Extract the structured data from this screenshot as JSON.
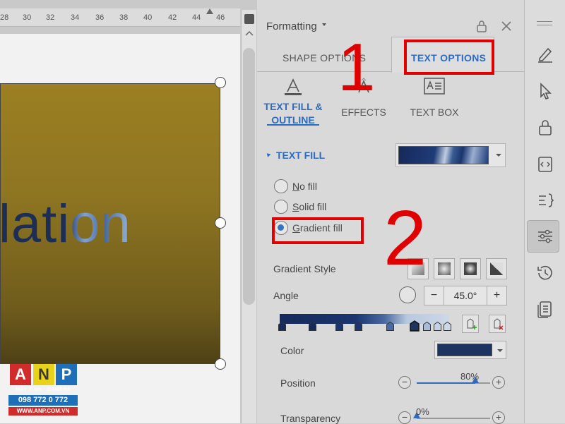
{
  "ruler": {
    "labels": [
      "28",
      "30",
      "32",
      "34",
      "36",
      "38",
      "40",
      "42",
      "44",
      "46"
    ]
  },
  "document": {
    "shape_text": "lation",
    "shape_fill_top": "#9c7f22",
    "shape_fill_bottom": "#4e4116"
  },
  "logo": {
    "letters": [
      "A",
      "N",
      "P"
    ],
    "letter_colors": [
      "#d12c2c",
      "#e8d21c",
      "#1f6fb8"
    ],
    "tagline": "MÁY TÍNH - CAMERA",
    "phone": "098 772 0 772",
    "website": "WWW.ANP.COM.VN"
  },
  "panel": {
    "title": "Formatting",
    "tabs": {
      "shape_options": "SHAPE OPTIONS",
      "text_options": "TEXT OPTIONS"
    },
    "subtabs": {
      "text_fill_outline": "TEXT FILL & OUTLINE",
      "effects": "EFFECTS",
      "text_box": "TEXT BOX"
    },
    "text_fill": {
      "section_label": "TEXT FILL",
      "options": [
        "No fill",
        "Solid fill",
        "Gradient fill"
      ],
      "selected": "Gradient fill"
    },
    "gradient": {
      "style_label": "Gradient Style",
      "angle_label": "Angle",
      "angle_value": "45.0°",
      "minus": "−",
      "plus": "+",
      "color_label": "Color",
      "color_value": "#1d3461",
      "position_label": "Position",
      "position_value": "80%",
      "position_fraction": 0.8,
      "transparency_label": "Transparency",
      "transparency_value": "0%",
      "transparency_fraction": 0
    }
  },
  "annotations": {
    "callout_one": "1",
    "callout_two": "2",
    "highlight_color": "#e00000"
  },
  "colors": {
    "accent": "#2e6bc0",
    "panel_bg": "#d9d9d9"
  },
  "icons": {
    "panel": [
      "lock-icon",
      "close-icon"
    ],
    "sidebar": [
      "pen-icon",
      "cursor-icon",
      "lock-icon",
      "code-edit-icon",
      "list-icon",
      "sliders-icon",
      "history-icon",
      "document-list-icon"
    ]
  }
}
